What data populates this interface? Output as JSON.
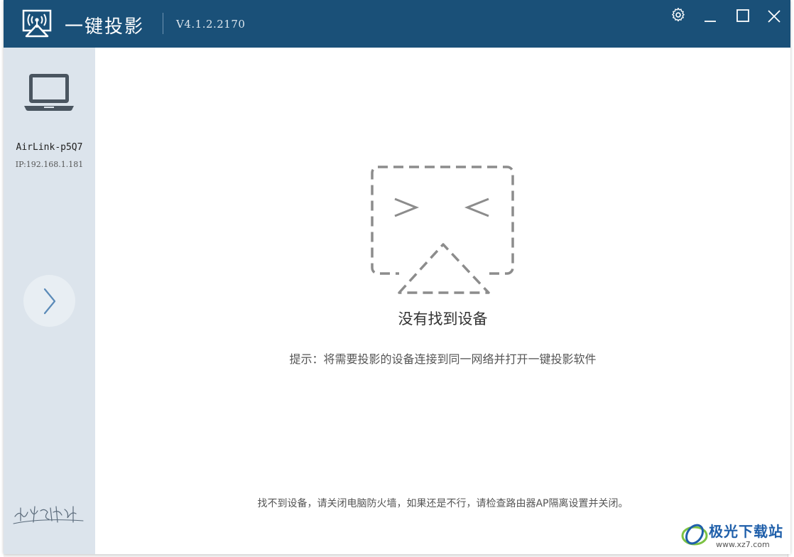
{
  "app": {
    "title": "一键投影",
    "version": "V4.1.2.2170"
  },
  "titlebar": {
    "settings_icon": "gear-icon",
    "minimize_icon": "minimize-icon",
    "maximize_icon": "maximize-icon",
    "close_icon": "close-icon",
    "background_color": "#1a5078"
  },
  "sidebar": {
    "device": {
      "icon": "laptop-icon",
      "name": "AirLink-p5Q7",
      "ip": "IP:192.168.1.181"
    },
    "next_icon": "chevron-right-icon",
    "slogan": "让投影更简单",
    "background_color": "#dce4ec"
  },
  "main": {
    "empty_state": {
      "icon": "no-device-screen-icon",
      "title": "没有找到设备",
      "hint": "提示：将需要投影的设备连接到同一网络并打开一键投影软件"
    },
    "footer_hint": "找不到设备，请关闭电脑防火墙，如果还是不行，请检查路由器AP隔离设置并关闭。"
  },
  "watermark": {
    "title": "极光下载站",
    "url": "www.xz7.com"
  }
}
